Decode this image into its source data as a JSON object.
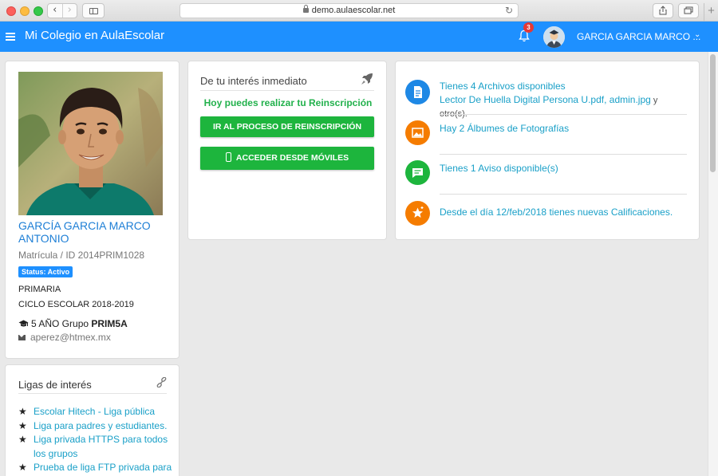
{
  "browser": {
    "url": "demo.aulaescolar.net",
    "back": "‹",
    "forward": "›",
    "reload": "↻",
    "new_tab": "+"
  },
  "nav": {
    "brand": "Mi Colegio en AulaEscolar",
    "notifications": "3",
    "user_name": "GARCIA GARCIA MARCO ...",
    "caret": "⌄"
  },
  "profile": {
    "name": "GARCÍA GARCIA MARCO ANTONIO",
    "matricula": "Matrícula / ID 2014PRIM1028",
    "status": "Status: Activo",
    "level": "PRIMARIA",
    "ciclo": "CICLO ESCOLAR 2018-2019",
    "grado_prefix": "5 AÑO Grupo",
    "grupo": "PRIM5A",
    "email": "aperez@htmex.mx"
  },
  "links": {
    "title": "Ligas de interés",
    "items": [
      "Escolar Hitech - Liga pública",
      "Liga para padres y estudiantes.",
      "Liga privada HTTPS para todos los grupos",
      "Prueba de liga FTP privada para"
    ]
  },
  "interest": {
    "title": "De tu interés inmediato",
    "reins_text": "Hoy puedes realizar tu Reinscripción",
    "btn_reins": "IR AL PROCESO DE REINSCRIPCIÓN",
    "btn_mobile": "ACCEDER DESDE MÓVILES"
  },
  "feed": {
    "files_title": "Tienes 4 Archivos disponibles",
    "files_link1": "Lector De Huella Digital Persona U.pdf",
    "files_sep": ", ",
    "files_link2": "admin.jpg",
    "files_more": " y otro(s).",
    "albums": "Hay 2 Álbumes de Fotografías",
    "notices": "Tienes 1 Aviso disponible(s)",
    "grades": "Desde el día 12/feb/2018 tienes nuevas Calificaciones."
  },
  "colors": {
    "primary": "#1e90ff",
    "green": "#1db53d",
    "files": "#1e88e5",
    "albums": "#f57c00",
    "notices": "#1db53d",
    "grades": "#f57c00"
  }
}
